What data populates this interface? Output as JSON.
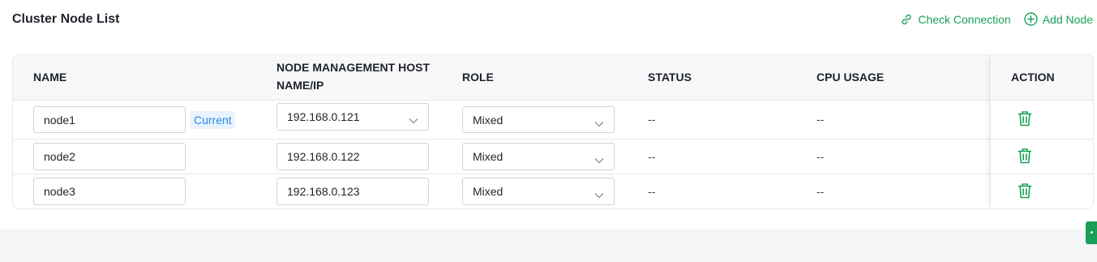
{
  "header": {
    "title": "Cluster Node List",
    "check_connection_label": "Check Connection",
    "add_node_label": "Add Node"
  },
  "colors": {
    "accent": "#18a058",
    "badge_bg": "#e8f3ff",
    "badge_text": "#2a8be3"
  },
  "table": {
    "columns": {
      "name": "NAME",
      "host_line1": "NODE MANAGEMENT HOST",
      "host_line2": "NAME/IP",
      "role": "ROLE",
      "status": "STATUS",
      "cpu": "CPU USAGE",
      "action": "ACTION"
    },
    "rows": [
      {
        "name": "node1",
        "badge": "Current",
        "host": "192.168.0.121",
        "role": "Mixed",
        "status": "--",
        "cpu": "--"
      },
      {
        "name": "node2",
        "host": "192.168.0.122",
        "role": "Mixed",
        "status": "--",
        "cpu": "--"
      },
      {
        "name": "node3",
        "host": "192.168.0.123",
        "role": "Mixed",
        "status": "--",
        "cpu": "--"
      }
    ]
  },
  "icons": {
    "check_connection": "link-icon",
    "add_node": "plus-circle-icon",
    "delete": "trash-icon",
    "select": "chevron-down-icon"
  }
}
